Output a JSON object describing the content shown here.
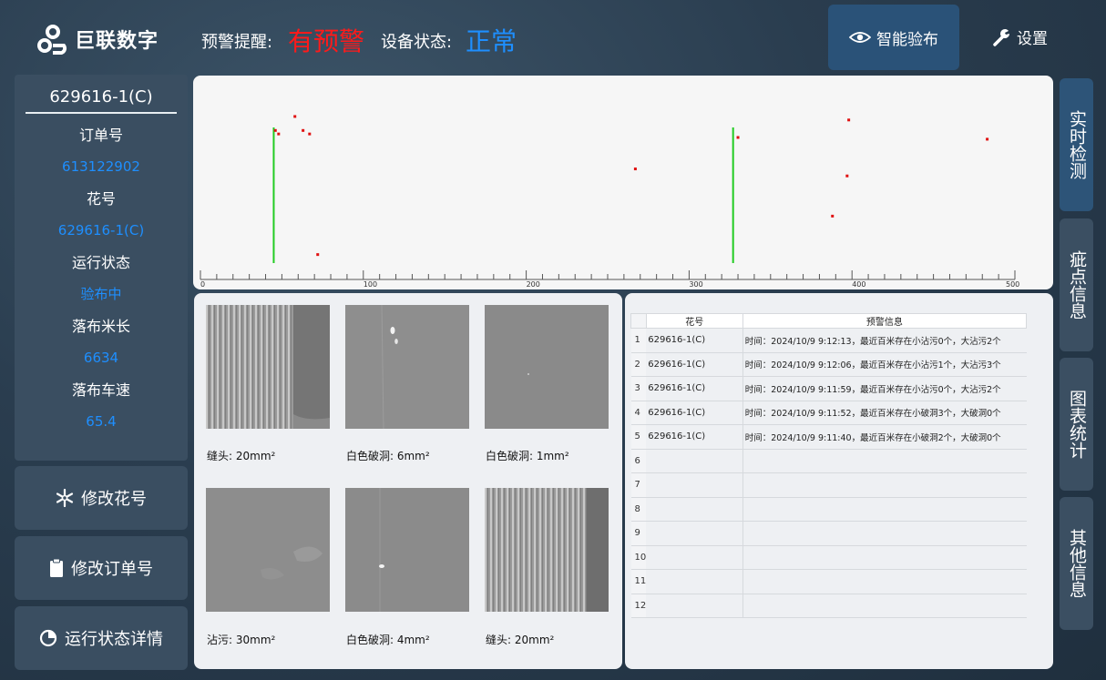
{
  "header": {
    "app_name": "巨联数字",
    "alert_label": "预警提醒:",
    "alert_value": "有预警",
    "status_label": "设备状态:",
    "status_value": "正常",
    "inspect_button": "智能验布",
    "settings_button": "设置",
    "colors": {
      "alert": "#ff1a1a",
      "status": "#1e8fff"
    }
  },
  "info_panel": {
    "title": "629616-1(C)",
    "fields": [
      {
        "label": "订单号",
        "value": "613122902"
      },
      {
        "label": "花号",
        "value": "629616-1(C)"
      },
      {
        "label": "运行状态",
        "value": "验布中"
      },
      {
        "label": "落布米长",
        "value": "6634"
      },
      {
        "label": "落布车速",
        "value": "65.4"
      }
    ]
  },
  "side_buttons": [
    {
      "label": "修改花号",
      "icon": "snowflake-icon"
    },
    {
      "label": "修改订单号",
      "icon": "clipboard-icon"
    },
    {
      "label": "运行状态详情",
      "icon": "pie-chart-icon"
    }
  ],
  "right_tabs": [
    "实时检测",
    "疵点信息",
    "图表统计",
    "其他信息"
  ],
  "chart_data": {
    "type": "scatter",
    "x_range": [
      0,
      500
    ],
    "x_ticks": [
      "0",
      "100",
      "200",
      "300",
      "400",
      "500"
    ],
    "markers": [
      45,
      327
    ],
    "points": [
      {
        "x": 46,
        "y": 0.79
      },
      {
        "x": 48,
        "y": 0.77
      },
      {
        "x": 58,
        "y": 0.87
      },
      {
        "x": 63,
        "y": 0.79
      },
      {
        "x": 67,
        "y": 0.77
      },
      {
        "x": 72,
        "y": 0.08
      },
      {
        "x": 267,
        "y": 0.57
      },
      {
        "x": 330,
        "y": 0.75
      },
      {
        "x": 388,
        "y": 0.3
      },
      {
        "x": 397,
        "y": 0.53
      },
      {
        "x": 398,
        "y": 0.85
      },
      {
        "x": 483,
        "y": 0.74
      }
    ],
    "colors": {
      "marker": "#22cc22",
      "point": "#e01010"
    }
  },
  "defect_images": [
    {
      "caption": "缝头: 20mm²",
      "kind": "seam"
    },
    {
      "caption": "白色破洞: 6mm²",
      "kind": "hole"
    },
    {
      "caption": "白色破洞: 1mm²",
      "kind": "plain"
    },
    {
      "caption": "沾污: 30mm²",
      "kind": "stain"
    },
    {
      "caption": "白色破洞: 4mm²",
      "kind": "hole"
    },
    {
      "caption": "缝头: 20mm²",
      "kind": "seam"
    }
  ],
  "alert_table": {
    "headers": [
      "花号",
      "预警信息"
    ],
    "rows": [
      {
        "no": "1",
        "flower": "629616-1(C)",
        "msg": "时间：2024/10/9 9:12:13，最近百米存在小沾污0个，大沾污2个"
      },
      {
        "no": "2",
        "flower": "629616-1(C)",
        "msg": "时间：2024/10/9 9:12:06，最近百米存在小沾污1个，大沾污3个"
      },
      {
        "no": "3",
        "flower": "629616-1(C)",
        "msg": "时间：2024/10/9 9:11:59，最近百米存在小沾污0个，大沾污2个"
      },
      {
        "no": "4",
        "flower": "629616-1(C)",
        "msg": "时间：2024/10/9 9:11:52，最近百米存在小破洞3个，大破洞0个"
      },
      {
        "no": "5",
        "flower": "629616-1(C)",
        "msg": "时间：2024/10/9 9:11:40，最近百米存在小破洞2个，大破洞0个"
      },
      {
        "no": "6",
        "flower": "",
        "msg": ""
      },
      {
        "no": "7",
        "flower": "",
        "msg": ""
      },
      {
        "no": "8",
        "flower": "",
        "msg": ""
      },
      {
        "no": "9",
        "flower": "",
        "msg": ""
      },
      {
        "no": "10",
        "flower": "",
        "msg": ""
      },
      {
        "no": "11",
        "flower": "",
        "msg": ""
      },
      {
        "no": "12",
        "flower": "",
        "msg": ""
      }
    ]
  }
}
